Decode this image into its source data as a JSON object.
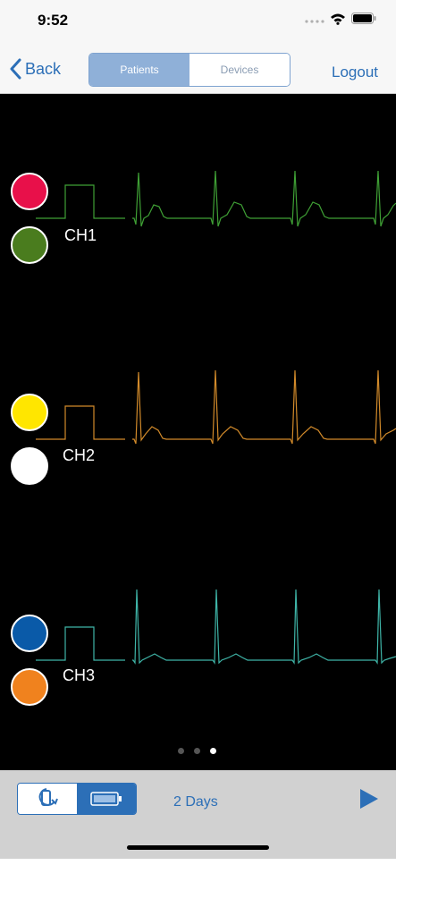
{
  "status_bar": {
    "time": "9:52",
    "icons": [
      "signal-dots-icon",
      "wifi-icon",
      "battery-icon"
    ]
  },
  "navbar": {
    "back_label": "Back",
    "segments": [
      {
        "label": "Patients",
        "selected": true
      },
      {
        "label": "Devices",
        "selected": false
      }
    ],
    "logout_label": "Logout"
  },
  "channels": [
    {
      "label": "CH1",
      "top_dot_color": "#e8104a",
      "bottom_dot_color": "#4a7c1e",
      "trace_color": "#3fa035"
    },
    {
      "label": "CH2",
      "top_dot_color": "#ffe600",
      "bottom_dot_color": "#ffffff",
      "trace_color": "#d28a2a"
    },
    {
      "label": "CH3",
      "top_dot_color": "#0a5aa8",
      "bottom_dot_color": "#f0821e",
      "trace_color": "#3fb5a8"
    }
  ],
  "pager": {
    "pages": 3,
    "current": 3
  },
  "toolbar": {
    "segments": [
      {
        "icon": "rotate-device-icon",
        "selected": false
      },
      {
        "icon": "battery-icon",
        "selected": true
      }
    ],
    "duration_label": "2 Days",
    "play_icon": "play-icon"
  },
  "colors": {
    "accent": "#2c6fb7",
    "monitor_bg": "#000000"
  }
}
